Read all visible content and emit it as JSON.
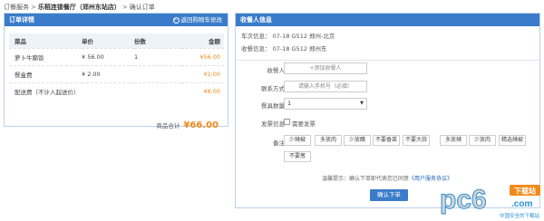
{
  "breadcrumb": {
    "home": "订餐服务",
    "restaurant": "乐稻连锁餐厅（郑州东站店）",
    "current": "确认订单"
  },
  "order": {
    "title": "订单详情",
    "back_link": "返回购物车修改",
    "headers": [
      "菜品",
      "单价",
      "份数",
      "金额"
    ],
    "items": [
      {
        "name": "萝卜牛腩饭",
        "price": "¥ 56.00",
        "qty": "1",
        "amount": "¥56.00"
      },
      {
        "name": "餐盒费",
        "price": "¥ 2.00",
        "qty": "",
        "amount": "¥2.00"
      },
      {
        "name": "配送费（不计入起送价）",
        "price": "",
        "qty": "",
        "amount": "¥8.00"
      }
    ],
    "subtotal_label": "商品合计",
    "subtotal_value": "¥66.00"
  },
  "recipient": {
    "title": "收餐人信息",
    "train_info_1": "车次信息：  07-18   G512   郑州-北京",
    "train_info_2": "收餐信息：  07-18   G512   郑州东",
    "name_label": "收餐人",
    "name_placeholder": "+添加收餐人",
    "phone_label": "联系方式",
    "phone_placeholder": "请输入手机号（必填）",
    "count_label": "餐具数量",
    "count_value": "1",
    "invoice_label": "发票信息",
    "invoice_option": "需要发票",
    "notes_label": "备注",
    "tags": [
      "少辣椒",
      "多放肉",
      "少放醋",
      "不要香菜",
      "不要大蒜",
      "多放辣",
      "少放肉",
      "精选辣椒",
      "不要葱"
    ],
    "notice_prefix": "温馨提示：确认下单即代表您已同意",
    "notice_link": "《用户服务协议》",
    "submit": "确认下单"
  },
  "watermark": {
    "brand": "pc6",
    "tag": "下载站",
    "domain": ".com",
    "slogan": "中国安全的下载站"
  },
  "colors": {
    "accent": "#3a7cc9",
    "price": "#f08a1a"
  }
}
